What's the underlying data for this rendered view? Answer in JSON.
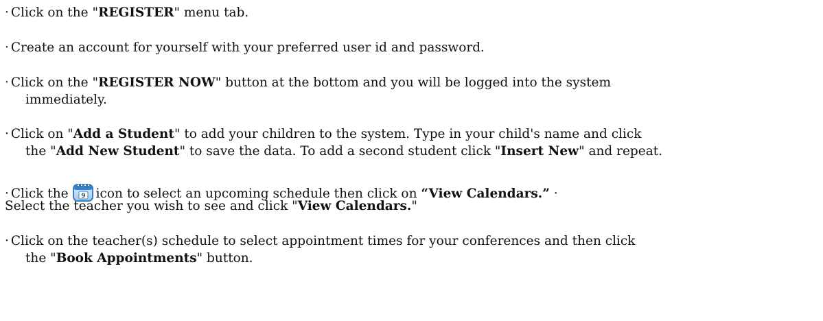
{
  "bullet_char": "·",
  "items": [
    {
      "lines": [
        [
          "Click on the \"",
          {
            "b": "REGISTER"
          },
          "\" menu tab."
        ]
      ]
    },
    {
      "lines": [
        [
          "Create an account for yourself with your preferred user id and password."
        ]
      ]
    },
    {
      "lines": [
        [
          "Click on the \"",
          {
            "b": "REGISTER NOW"
          },
          "\" button at the bottom and you will be logged into the system"
        ],
        [
          "immediately."
        ]
      ]
    },
    {
      "lines": [
        [
          "Click on \"",
          {
            "b": "Add a Student"
          },
          "\" to add your children to the system. Type in your child's name and click"
        ],
        [
          "the \"",
          {
            "b": "Add New Student"
          },
          "\" to save the data. To add a second student click \"",
          {
            "b": "Insert New"
          },
          "\" and repeat."
        ]
      ]
    }
  ],
  "calendar_line": {
    "before_icon": "Click the",
    "icon": "calendar-icon",
    "after_icon": "icon to select an upcoming schedule then click on ",
    "bold": "“View Calendars.”",
    "trailing_bullet": "·"
  },
  "select_line": {
    "text": "Select the teacher you wish to see and click \"",
    "bold": "View Calendars.",
    "end": "\""
  },
  "last_item": {
    "line1": "Click on the teacher(s) schedule to select appointment times for your conferences and then click",
    "line2_pre": "the \"",
    "line2_bold": "Book Appointments",
    "line2_post": "\" button."
  },
  "colors": {
    "text": "#111111",
    "icon_blue": "#3a7fc4",
    "icon_light": "#cfe6f7"
  }
}
